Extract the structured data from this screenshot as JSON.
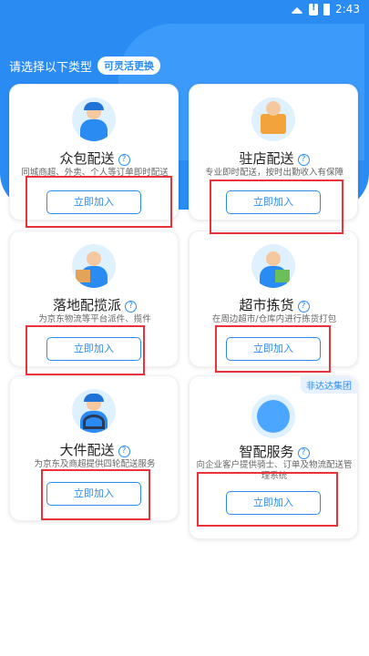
{
  "status": {
    "time": "2:43"
  },
  "prompt": {
    "text": "请选择以下类型",
    "badge": "可灵活更换"
  },
  "cards": [
    {
      "title": "众包配送",
      "desc": "同城商超、外卖、个人等订单即时配送",
      "button": "立即加入",
      "icon": "courier-scooter-icon"
    },
    {
      "title": "驻店配送",
      "desc": "专业即时配送，按时出勤收入有保障",
      "button": "立即加入",
      "icon": "storefront-icon"
    },
    {
      "title": "落地配揽派",
      "desc": "为京东物流等平台派件、揽件",
      "button": "立即加入",
      "icon": "courier-package-icon"
    },
    {
      "title": "超市拣货",
      "desc": "在周边超市/仓库内进行拣货打包",
      "button": "立即加入",
      "icon": "picker-basket-icon"
    },
    {
      "title": "大件配送",
      "desc": "为京东及商超提供四轮配送服务",
      "button": "立即加入",
      "icon": "driver-wheel-icon"
    },
    {
      "title": "智配服务",
      "desc": "向企业客户提供骑士、订单及物流配送管理系统",
      "button": "立即加入",
      "icon": "globe-icon",
      "corner": "非达达集团"
    }
  ]
}
